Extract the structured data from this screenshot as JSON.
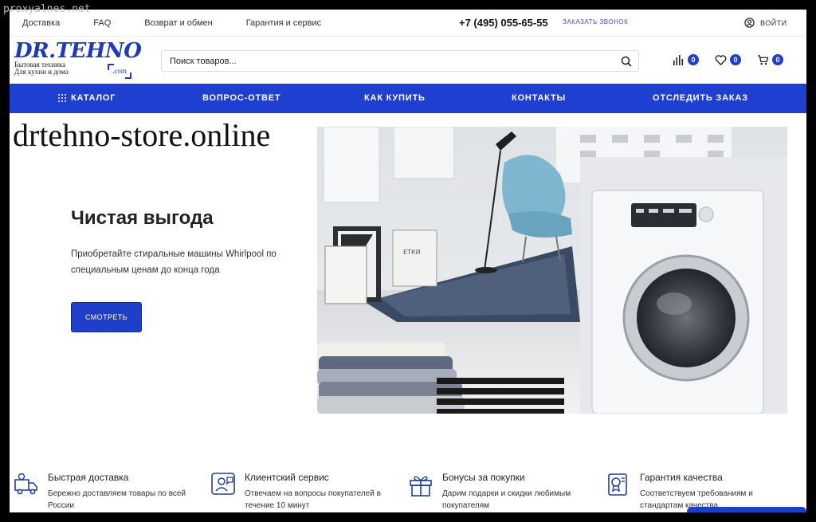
{
  "watermark": "proxyalnes.net",
  "topbar": {
    "links": [
      "Доставка",
      "FAQ",
      "Возврат и обмен",
      "Гарантия и сервис"
    ],
    "phone": "+7 (495) 055-65-55",
    "callback": "ЗАКАЗАТЬ ЗВОНОК",
    "login": "ВОЙТИ"
  },
  "logo": {
    "name": "DR.TEHNO",
    "tagline1": "Бытовая техника",
    "tagline2": "Для кухни и дома",
    "com": ".com"
  },
  "search": {
    "placeholder": "Поиск товаров..."
  },
  "header_icons": [
    {
      "icon": "compare-icon",
      "count": "0"
    },
    {
      "icon": "heart-icon",
      "count": "0"
    },
    {
      "icon": "cart-icon",
      "count": "0"
    }
  ],
  "nav": [
    "КАТАЛОГ",
    "ВОПРОС-ОТВЕТ",
    "КАК КУПИТЬ",
    "КОНТАКТЫ",
    "ОТСЛЕДИТЬ ЗАКАЗ"
  ],
  "hero": {
    "domain": "drtehno-store.online",
    "title": "Чистая выгода",
    "description": "Приобретайте стиральные машины Whirlpool по специальным ценам до конца года",
    "button": "СМОТРЕТЬ"
  },
  "features": [
    {
      "icon": "delivery-truck-icon",
      "title": "Быстрая доставка",
      "text": "Бережно доставляем товары по всей России"
    },
    {
      "icon": "support-agent-icon",
      "title": "Клиентский сервис",
      "text": "Отвечаем на вопросы покупателей в течение 10 минут"
    },
    {
      "icon": "gift-icon",
      "title": "Бонусы за покупки",
      "text": "Дарим подарки и скидки любимым покупателям"
    },
    {
      "icon": "certificate-icon",
      "title": "Гарантия качества",
      "text": "Соответствуем требованиям и стандартам качества"
    }
  ],
  "colors": {
    "brand": "#1f3fd0",
    "text": "#222222"
  }
}
